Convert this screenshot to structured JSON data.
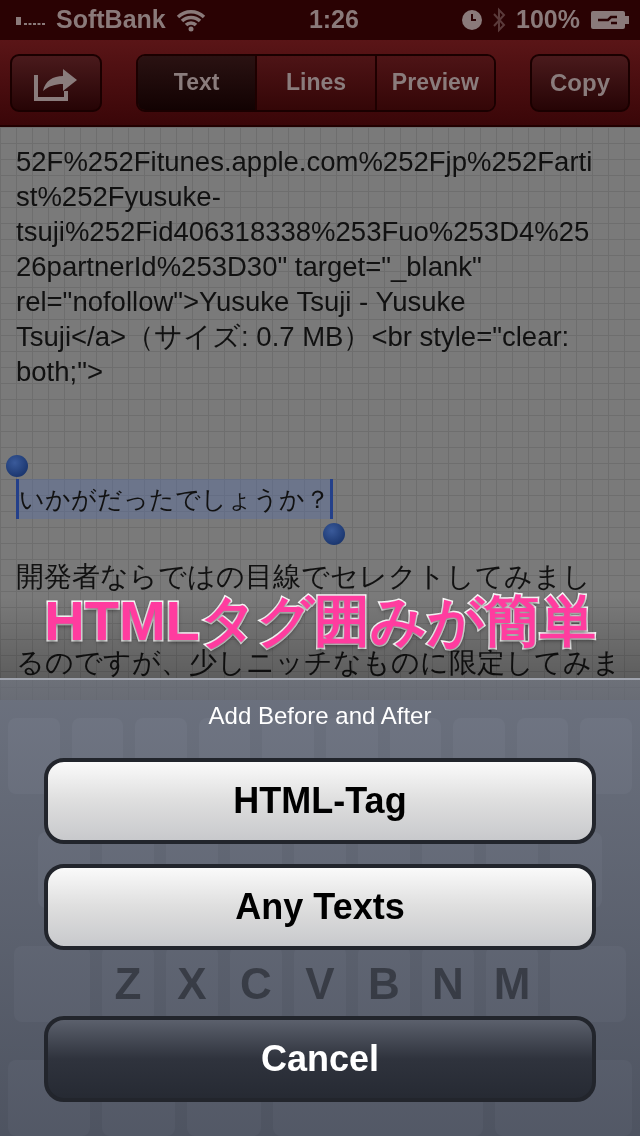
{
  "status_bar": {
    "carrier": "SoftBank",
    "time": "1:26",
    "battery": "100%"
  },
  "toolbar": {
    "tabs": [
      {
        "label": "Text",
        "selected": true
      },
      {
        "label": "Lines",
        "selected": false
      },
      {
        "label": "Preview",
        "selected": false
      }
    ],
    "copy_button": "Copy"
  },
  "document": {
    "paragraphs": [
      {
        "kind": "text",
        "lines": [
          "52F%252Fitunes.apple.com%252Fjp%252Farti",
          "st%252Fyusuke-",
          "tsuji%252Fid406318338%253Fuo%253D4%25",
          "26partnerId%253D30\" target=\"_blank\"",
          "rel=\"nofollow\">Yusuke Tsuji - Yusuke",
          "Tsuji</a>（サイズ: 0.7 MB）<br style=\"clear:",
          "both;\">"
        ]
      },
      {
        "kind": "selection",
        "lines": [
          "いかがだったでしょうか？"
        ]
      },
      {
        "kind": "text",
        "lines": [
          "開発者ならではの目線でセレクトしてみまし"
        ]
      },
      {
        "kind": "text",
        "lines": [
          "るのですが、少しニッチなものに限定してみま"
        ]
      }
    ]
  },
  "caption": "HTMLタグ囲みが簡単",
  "keyboard": {
    "visible_keys": [
      "Z",
      "X",
      "C",
      "V",
      "B",
      "N",
      "M"
    ]
  },
  "action_sheet": {
    "title": "Add Before and After",
    "buttons": [
      {
        "label": "HTML-Tag",
        "kind": "default"
      },
      {
        "label": "Any Texts",
        "kind": "default"
      },
      {
        "label": "Cancel",
        "kind": "cancel"
      }
    ]
  }
}
